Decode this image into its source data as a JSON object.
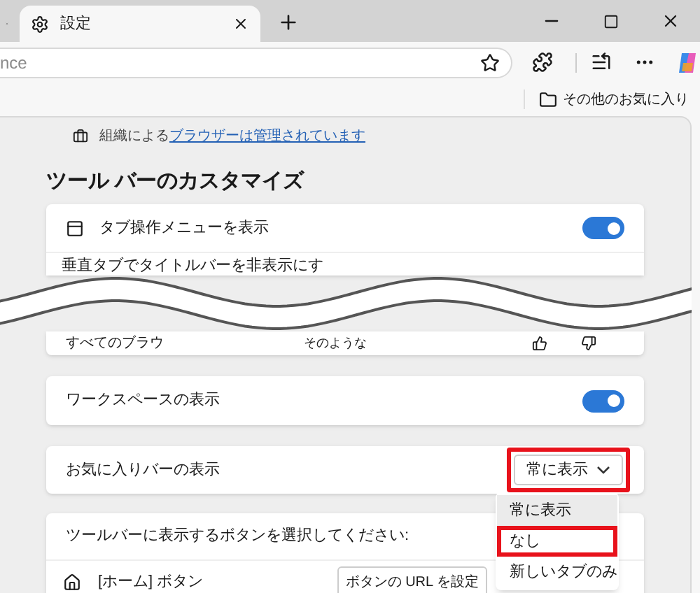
{
  "tabs": [
    {
      "selected": false
    },
    {
      "label": "設定",
      "selected": true
    }
  ],
  "address_bar": {
    "value": "nce"
  },
  "favorites_bar": {
    "items": [
      {
        "label": "その他のお気に入り"
      }
    ]
  },
  "banner": {
    "text": "組織による",
    "link": "ブラウザーは管理されています"
  },
  "section": {
    "title": "ツール バーのカスタマイズ"
  },
  "tab_menu_row": {
    "label": "タブ操作メニューを表示",
    "on": true
  },
  "vertical_tabs_row": {
    "label": "垂直タブでタイトルバーを非表示にす"
  },
  "feedback_row": {
    "label": "すべてのブラウ",
    "note": "そのような"
  },
  "workspaces_row": {
    "label": "ワークスペースの表示",
    "on": true
  },
  "favorites_bar_row": {
    "label": "お気に入りバーの表示",
    "select": {
      "value": "常に表示",
      "highlighted": true
    },
    "options": [
      {
        "label": "常に表示",
        "selected": true,
        "highlighted": false
      },
      {
        "label": "なし",
        "selected": false,
        "highlighted": true
      },
      {
        "label": "新しいタブのみ",
        "selected": false,
        "highlighted": false
      }
    ]
  },
  "toolbar_buttons": {
    "title": "ツールバーに表示するボタンを選択してください:",
    "rows": [
      {
        "label": "[ホーム] ボタン",
        "url_button": "ボタンの URL を設定"
      }
    ]
  }
}
